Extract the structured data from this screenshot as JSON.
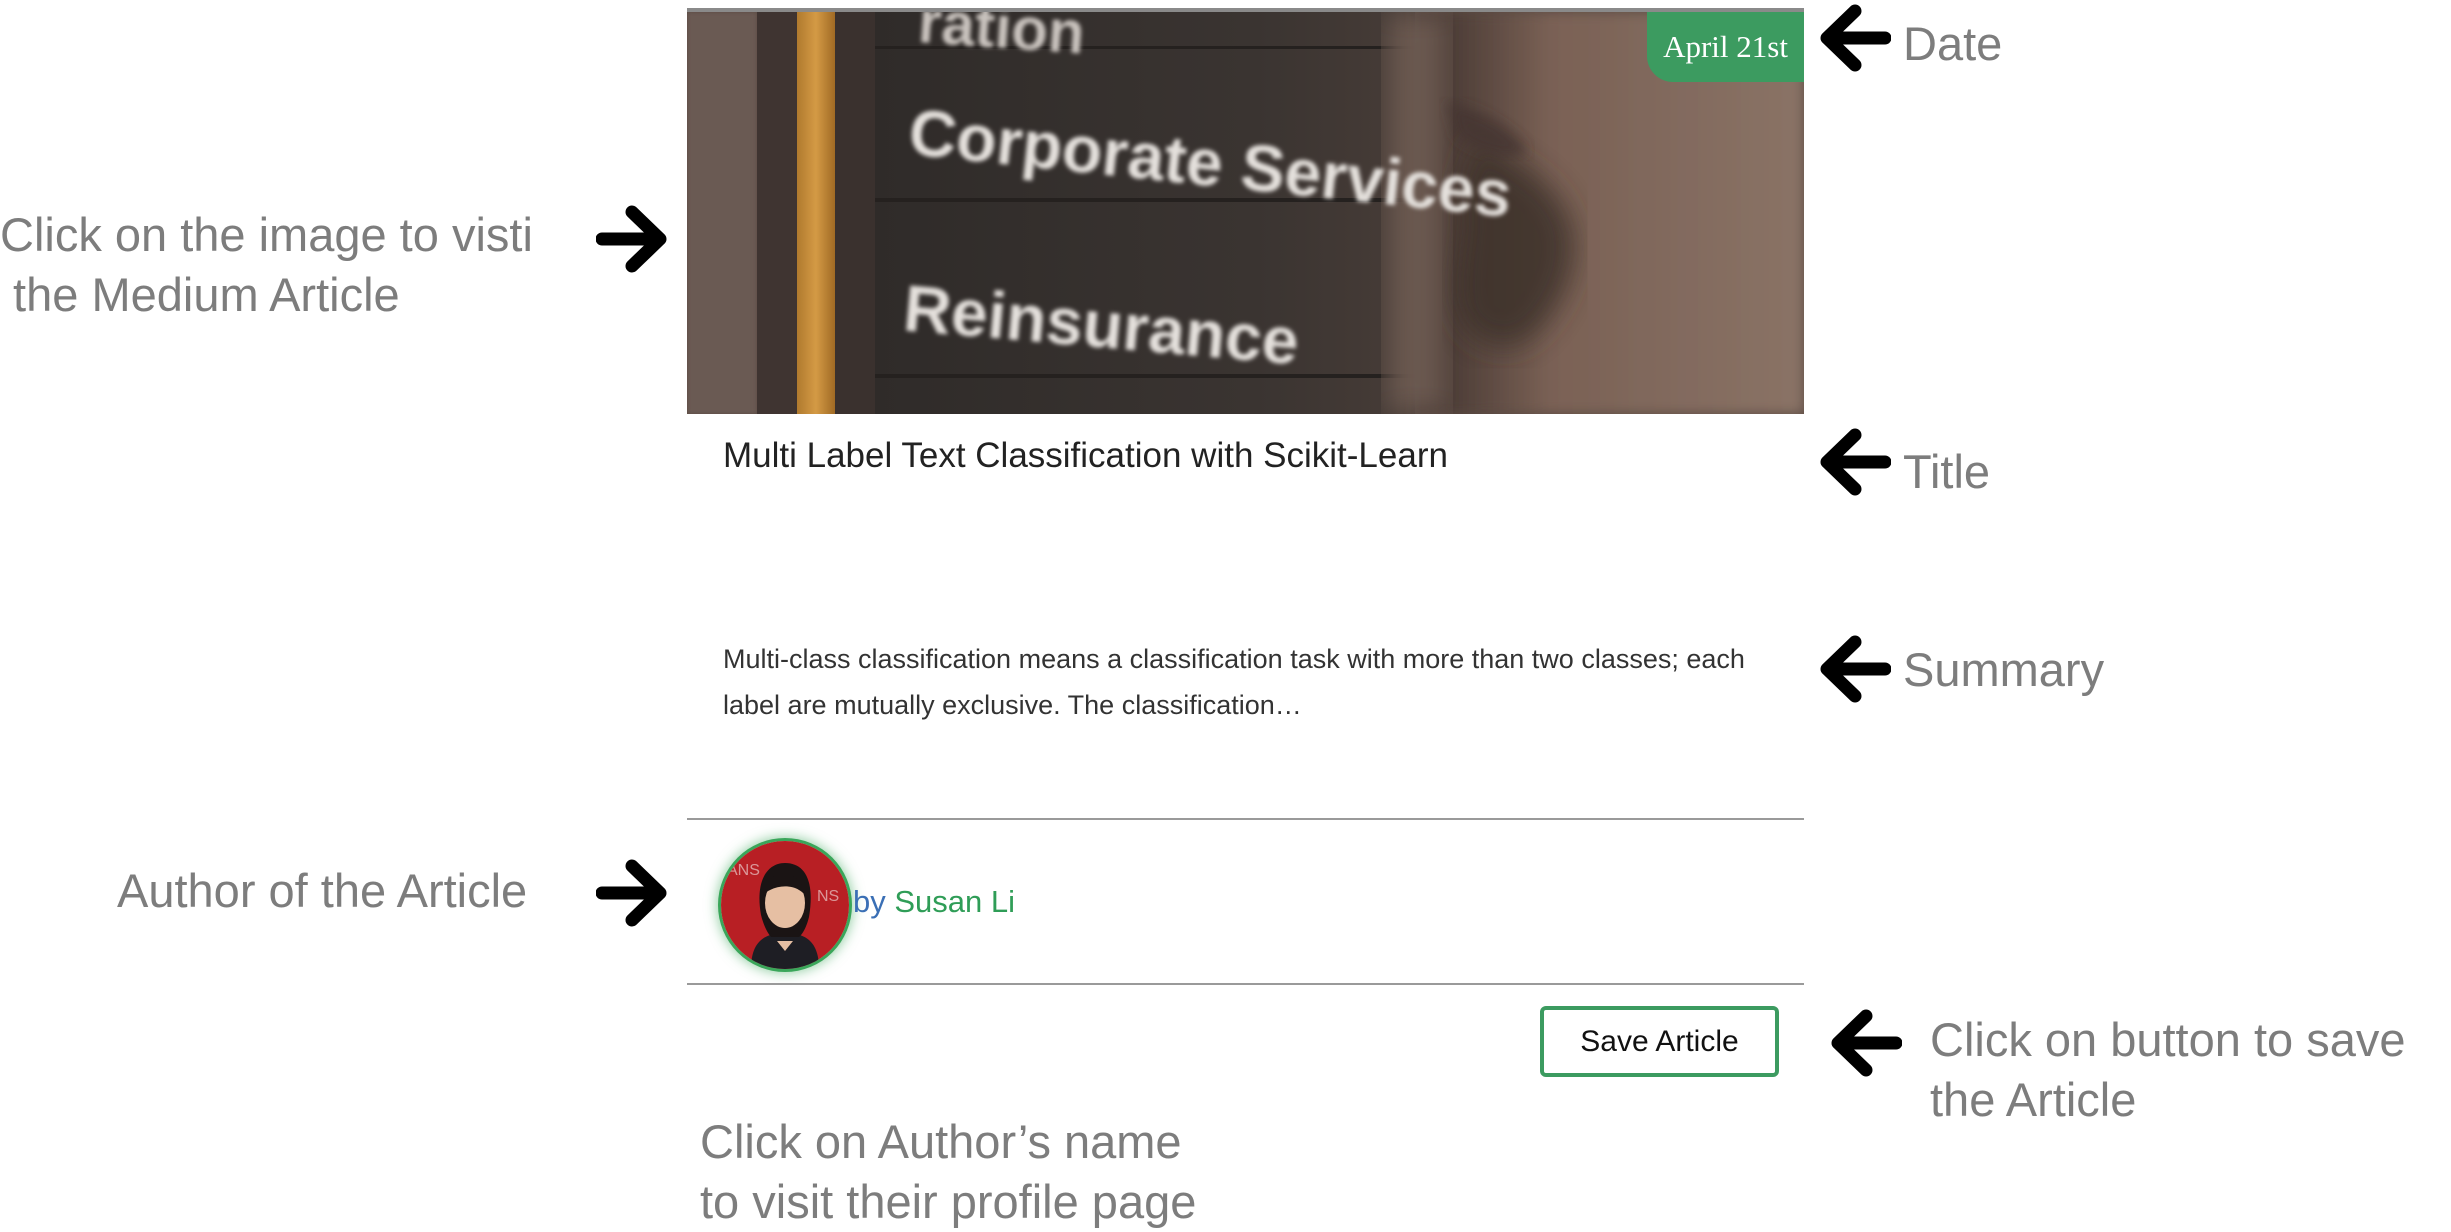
{
  "card": {
    "date": "April 21st",
    "title": "Multi Label Text Classification with Scikit-Learn",
    "summary": "Multi-class classification means a classification task with more than two classes; each label are mutually exclusive. The classification…",
    "by_label": "by",
    "author": "Susan Li",
    "save_label": "Save Article",
    "accent_color": "#3c9b60",
    "hero_sign": {
      "line_top": "ration",
      "line_1": "Corporate Services",
      "line_2": "Reinsurance"
    }
  },
  "annotations": {
    "image": "Click on the image to visti\n the Medium Article",
    "date": "Date",
    "title": "Title",
    "summary": "Summary",
    "author": "Author of the Article",
    "author_link": "Click on Author’s name\nto visit their profile page",
    "save": "Click on button to save\nthe Article"
  },
  "icons": {
    "arrow": "arrow-icon",
    "author_photo": "author-avatar"
  }
}
